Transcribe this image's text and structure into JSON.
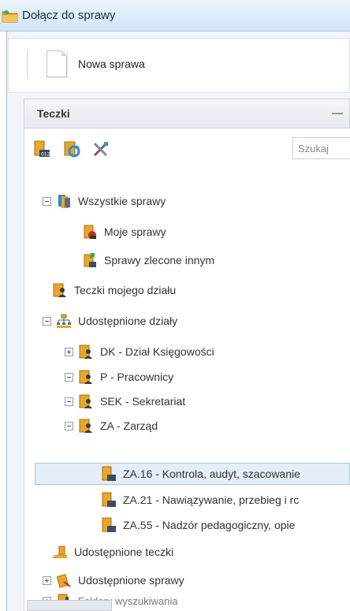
{
  "window": {
    "title": "Dołącz do sprawy"
  },
  "toolbar": {
    "new_case_label": "Nowa sprawa"
  },
  "panel": {
    "title": "Teczki",
    "search_placeholder": "Szukaj",
    "toolbar_icons": [
      "folder-counter-icon",
      "refresh-icon",
      "tools-icon"
    ]
  },
  "tree": [
    {
      "id": "all-cases",
      "label": "Wszystkie sprawy",
      "expander": "minus",
      "icon": "cases-stack-icon"
    },
    {
      "id": "my-cases",
      "label": "Moje sprawy",
      "expander": "none",
      "icon": "folder-user-icon"
    },
    {
      "id": "delegated",
      "label": "Sprawy zlecone innym",
      "expander": "none",
      "icon": "folder-delegate-icon"
    },
    {
      "id": "department",
      "label": "Teczki mojego działu",
      "expander": "none",
      "icon": "folder-person-icon"
    },
    {
      "id": "shared-departments",
      "label": "Udostępnione działy",
      "expander": "minus",
      "icon": "org-chart-icon"
    },
    {
      "id": "dk",
      "label": "DK - Dział Księgowości",
      "expander": "plus",
      "icon": "folder-person-icon"
    },
    {
      "id": "p",
      "label": "P - Pracownicy",
      "expander": "minus",
      "icon": "folder-person-icon"
    },
    {
      "id": "sek",
      "label": "SEK - Sekretariat",
      "expander": "minus",
      "icon": "folder-person-icon"
    },
    {
      "id": "za",
      "label": "ZA - Zarząd",
      "expander": "minus",
      "icon": "folder-person-icon"
    },
    {
      "id": "za16",
      "label": "ZA.16 - Kontrola, audyt, szacowanie",
      "expander": "none",
      "icon": "folder-counter-icon",
      "selected": true
    },
    {
      "id": "za21",
      "label": "ZA.21 - Nawiązywanie, przebieg i rc",
      "expander": "none",
      "icon": "folder-counter-icon"
    },
    {
      "id": "za55",
      "label": "ZA.55 - Nadzór pedagogiczny, opie",
      "expander": "none",
      "icon": "folder-counter-icon"
    },
    {
      "id": "shared-folders",
      "label": "Udostępnione teczki",
      "expander": "none",
      "icon": "shared-folder-icon"
    },
    {
      "id": "shared-cases",
      "label": "Udostępnione sprawy",
      "expander": "plus",
      "icon": "shared-cases-icon"
    },
    {
      "id": "search-folders",
      "label": "Foldery wyszukiwania",
      "expander": "plus",
      "icon": "search-folder-icon"
    }
  ]
}
